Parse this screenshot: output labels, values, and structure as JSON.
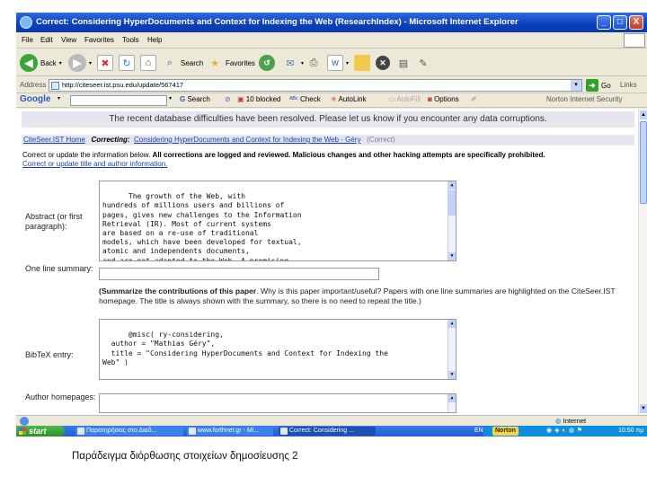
{
  "window": {
    "title": "Correct: Considering HyperDocuments and Context for Indexing the Web (ResearchIndex) - Microsoft Internet Explorer",
    "minimize": "_",
    "maximize": "□",
    "close": "X"
  },
  "menu": [
    "File",
    "Edit",
    "View",
    "Favorites",
    "Tools",
    "Help"
  ],
  "toolbar": {
    "back": "Back",
    "search": "Search",
    "favorites": "Favorites"
  },
  "address": {
    "label": "Address",
    "url": "http://citeseer.ist.psu.edu/update/567417",
    "go": "Go",
    "links": "Links"
  },
  "google_toolbar": {
    "logo": "Google",
    "search": "Search",
    "blocked": "10 blocked",
    "check": "Check",
    "autolink": "AutoLink",
    "autofill": "AutoFill",
    "options": "Options",
    "norton": "Norton Internet Security"
  },
  "page": {
    "banner": "The recent database difficulties have been resolved. Please let us know if you encounter any data corruptions.",
    "breadcrumb": {
      "home": "CiteSeer.IST Home",
      "correcting_label": "Correcting:",
      "doc_link": "Considering HyperDocuments and Context for Indexing the Web - Géry",
      "correct_link": "(Correct)"
    },
    "intro": {
      "text": "Correct or update the information below.",
      "bold": "All corrections are logged and reviewed. Malicious changes and other hacking attempts are specifically prohibited.",
      "link": "Correct or update title and author information."
    },
    "abstract": {
      "label": "Abstract (or first paragraph):",
      "value": "The growth of the Web, with\nhundreds of millions users and billions of\npages, gives new challenges to the Information\nRetrieval (IR). Most of current systems\nare based on a re-use of traditional\nmodels, which have been developed for textual,\natomic and independents documents,\nand are not adapted to the Web. A promising\nresearch orientation consists in studying"
    },
    "summary": {
      "label": "One line summary:",
      "help_bold": "(Summarize the contributions of this paper",
      "help_text": ". Why is this paper important/useful? Papers with one line summaries are highlighted on the CiteSeer.IST homepage. The title is always shown with the summary, so there is no need to repeat the title.)"
    },
    "bibtex": {
      "label": "BibTeX entry:",
      "value": "@misc( ry-considering,\n  author = \"Mathias Géry\",\n  title = \"Considering HyperDocuments and Context for Indexing the\nWeb\" )"
    },
    "homepages": {
      "label": "Author homepages:"
    }
  },
  "status": {
    "zone": "Internet"
  },
  "taskbar": {
    "start": "start",
    "tasks": [
      "Παρατηρήσεις στο Διαδ...",
      "www.forthnet.gr - Mi...",
      "Correct: Considering ..."
    ],
    "lang": "EN",
    "norton": "Norton",
    "clock": "10:50 πμ"
  },
  "caption": "Παράδειγμα διόρθωσης στοιχείων δημοσίευσης 2"
}
